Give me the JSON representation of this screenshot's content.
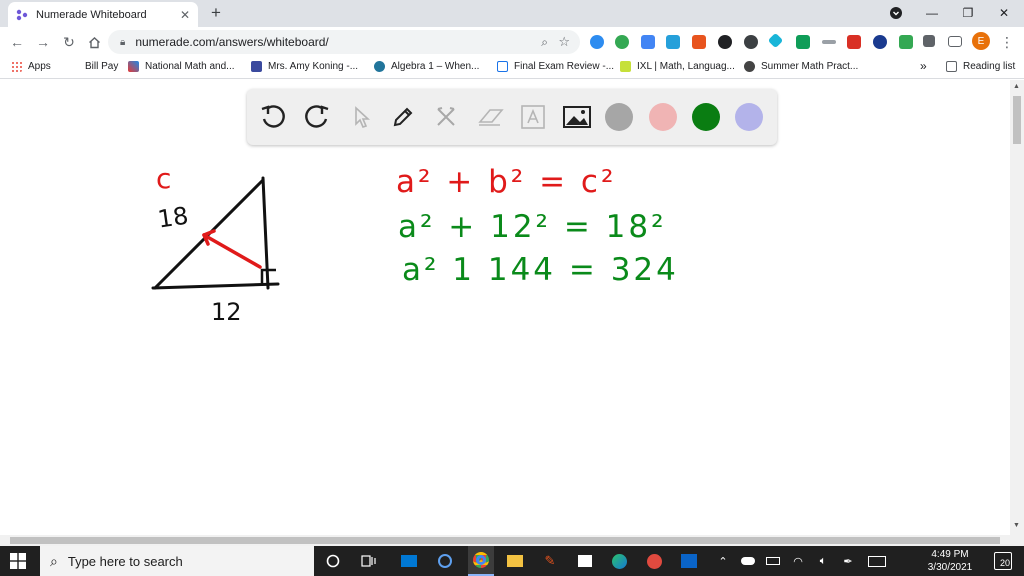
{
  "browser": {
    "tab_title": "Numerade Whiteboard",
    "tab_close": "✕",
    "new_tab": "+",
    "url": "numerade.com/answers/whiteboard/",
    "win_min": "—",
    "win_restore": "❐",
    "win_close": "✕",
    "profile_initial": "E"
  },
  "bookmarks": {
    "items": [
      {
        "label": "Apps",
        "icon": "apps-grid-icon"
      },
      {
        "label": "Bill Pay",
        "icon": "bill-pay-icon"
      },
      {
        "label": "National Math and...",
        "icon": "national-math-icon"
      },
      {
        "label": "Mrs. Amy Koning -...",
        "icon": "classroom-icon"
      },
      {
        "label": "Algebra 1 – When...",
        "icon": "wordpress-icon"
      },
      {
        "label": "Final Exam Review -...",
        "icon": "doc-icon"
      },
      {
        "label": "IXL | Math, Languag...",
        "icon": "ixl-icon"
      },
      {
        "label": "Summer Math Pract...",
        "icon": "summer-math-icon"
      }
    ],
    "more": "»",
    "reading_list": "Reading list"
  },
  "whiteboard": {
    "tools": [
      "undo-icon",
      "redo-icon",
      "pointer-icon",
      "pen-icon",
      "tools-icon",
      "eraser-icon",
      "text-icon",
      "image-icon"
    ],
    "colors": [
      "#a6a6a6",
      "#f0b4b4",
      "#0a7d12",
      "#b3b3ea"
    ],
    "drawing": {
      "label_c": "c",
      "label_18": "18",
      "label_12": "12",
      "eq1": "a² + b² = c²",
      "eq2": "a² + 12² = 18²",
      "eq3": "a² 1 144 = 324",
      "red": "#e01a1a",
      "green": "#0a8a1a",
      "ink": "#111111"
    }
  },
  "taskbar": {
    "search_placeholder": "Type here to search",
    "time": "4:49 PM",
    "date": "3/30/2021",
    "notifications": "20"
  }
}
